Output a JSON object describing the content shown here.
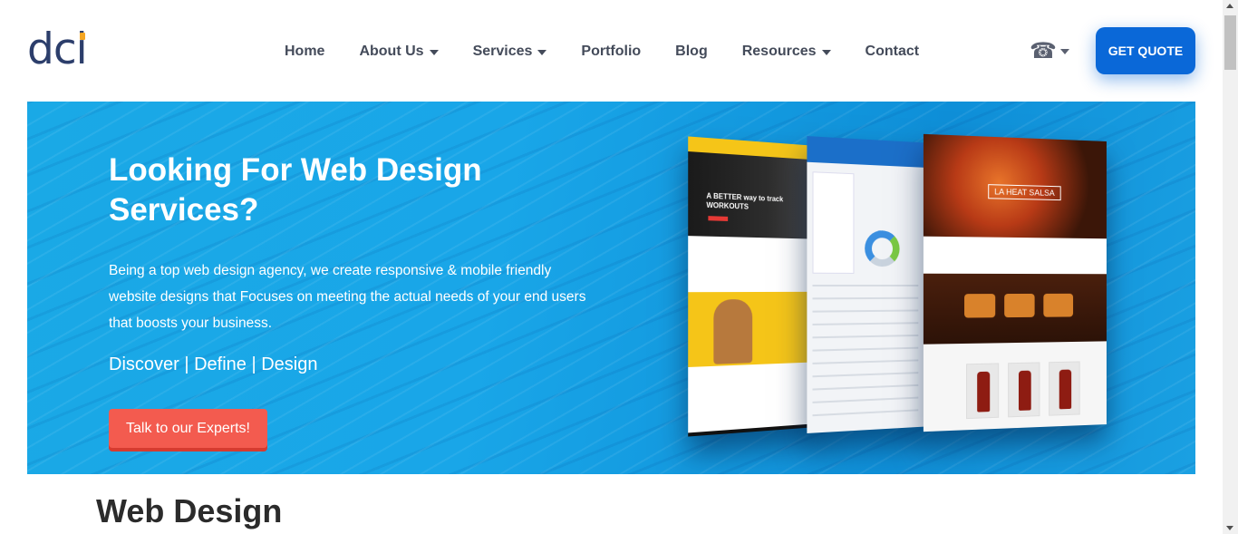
{
  "brand": {
    "logo_text": "dci",
    "colors": {
      "navy": "#2c3e6b",
      "accent": "#f5a623",
      "primary": "#0a68d8",
      "cta": "#f35b4f"
    }
  },
  "nav": {
    "items": [
      {
        "label": "Home",
        "has_dropdown": false
      },
      {
        "label": "About Us",
        "has_dropdown": true
      },
      {
        "label": "Services",
        "has_dropdown": true
      },
      {
        "label": "Portfolio",
        "has_dropdown": false
      },
      {
        "label": "Blog",
        "has_dropdown": false
      },
      {
        "label": "Resources",
        "has_dropdown": true
      },
      {
        "label": "Contact",
        "has_dropdown": false
      }
    ],
    "phone_icon": "telephone-icon",
    "quote_label": "GET QUOTE"
  },
  "hero": {
    "title": "Looking For Web Design Services?",
    "description": "Being a top web design agency, we create responsive & mobile friendly website designs that Focuses on meeting the actual needs of your end users that boosts your business.",
    "tagline": "Discover | Define | Design",
    "cta_label": "Talk to our Experts!",
    "mockups": {
      "fitness_headline": "A BETTER way to track WORKOUTS",
      "salsa_badge": "LA HEAT SALSA"
    }
  },
  "section": {
    "title": "Web Design"
  }
}
